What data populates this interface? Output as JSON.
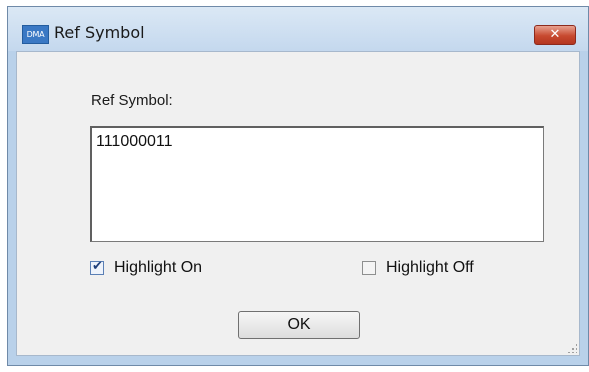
{
  "window": {
    "icon_text": "DMA",
    "title": "Ref Symbol",
    "close_glyph": "✕"
  },
  "form": {
    "ref_label": "Ref Symbol:",
    "ref_value": "111000011",
    "highlight_on": {
      "label": "Highlight On",
      "checked": true
    },
    "highlight_off": {
      "label": "Highlight Off",
      "checked": false
    },
    "ok_label": "OK"
  },
  "icons": {
    "app": "dma-app-icon",
    "close": "close-icon",
    "check": "checkmark-icon",
    "grip": "resize-grip-icon"
  },
  "colors": {
    "titlebar": "#c4d8ee",
    "close_button": "#c7492f",
    "dialog_bg": "#f0f0f0"
  }
}
